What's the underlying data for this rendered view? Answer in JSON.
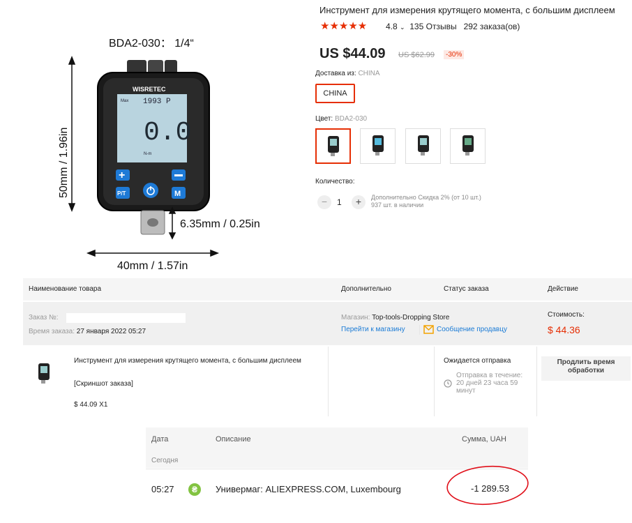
{
  "product": {
    "title": "Инструмент для измерения крутящего момента, с большим дисплеем",
    "stars": "★★★★★",
    "rating": "4.8",
    "reviews": "135 Отзывы",
    "orders": "292 заказа(ов)",
    "price": "US $44.09",
    "old_price": "US $62.99",
    "discount": "-30%",
    "shipping_label": "Доставка из:",
    "shipping_value": "CHINA",
    "shipping_option": "CHINA",
    "color_label": "Цвет:",
    "color_value": "BDA2-030",
    "quantity_label": "Количество:",
    "quantity": "1",
    "quantity_minus": "−",
    "quantity_plus": "+",
    "extra_discount": "Дополнительно Скидка 2% (от 10 шт.)",
    "stock": "937 шт. в наличии"
  },
  "image": {
    "model_label": "BDA2-030： 1/4“",
    "height_label": "50mm / 1.96in",
    "drive_label": "6.35mm / 0.25in",
    "width_label": "40mm / 1.57in",
    "brand": "WISRETEC",
    "max_label": "Max",
    "max_value": "1993 P",
    "reading": "0.0",
    "unit": "N-m",
    "btn_pt": "P/T",
    "btn_m": "M"
  },
  "order_table": {
    "headers": [
      "Наименование товара",
      "Дополнительно",
      "Статус заказа",
      "Действие"
    ],
    "order_no_label": "Заказ №:",
    "order_time_label": "Время заказа:",
    "order_time": "27 января 2022 05:27",
    "store_label": "Магазин:",
    "store_name": "Top-tools-Dropping Store",
    "go_to_store": "Перейти к магазину",
    "message_seller": "Сообщение продавцу",
    "cost_label": "Стоимость:",
    "cost": "$ 44.36",
    "item_title": "Инструмент для измерения крутящего момента, с большим дисплеем",
    "screenshot_link": "[Скриншот заказа]",
    "item_price": "$ 44.09 X1",
    "status": "Ожидается отправка",
    "ship_within_1": "Отправка в течение:",
    "ship_within_2": "20 дней 23 часа 59",
    "ship_within_3": "минут",
    "extend_button_1": "Продлить время",
    "extend_button_2": "обработки"
  },
  "bank": {
    "col_date": "Дата",
    "col_desc": "Описание",
    "col_amount": "Сумма, UAH",
    "group": "Сегодня",
    "rows": [
      {
        "time": "05:27",
        "icon": "₴",
        "description": "Универмаг: ALIEXPRESS.COM, Luxembourg",
        "amount": "-1 289.53"
      }
    ]
  },
  "colors": {
    "accent": "#e62e04",
    "link": "#1a7bd6",
    "bank_icon": "#82c341",
    "annotation": "#e0101a"
  }
}
